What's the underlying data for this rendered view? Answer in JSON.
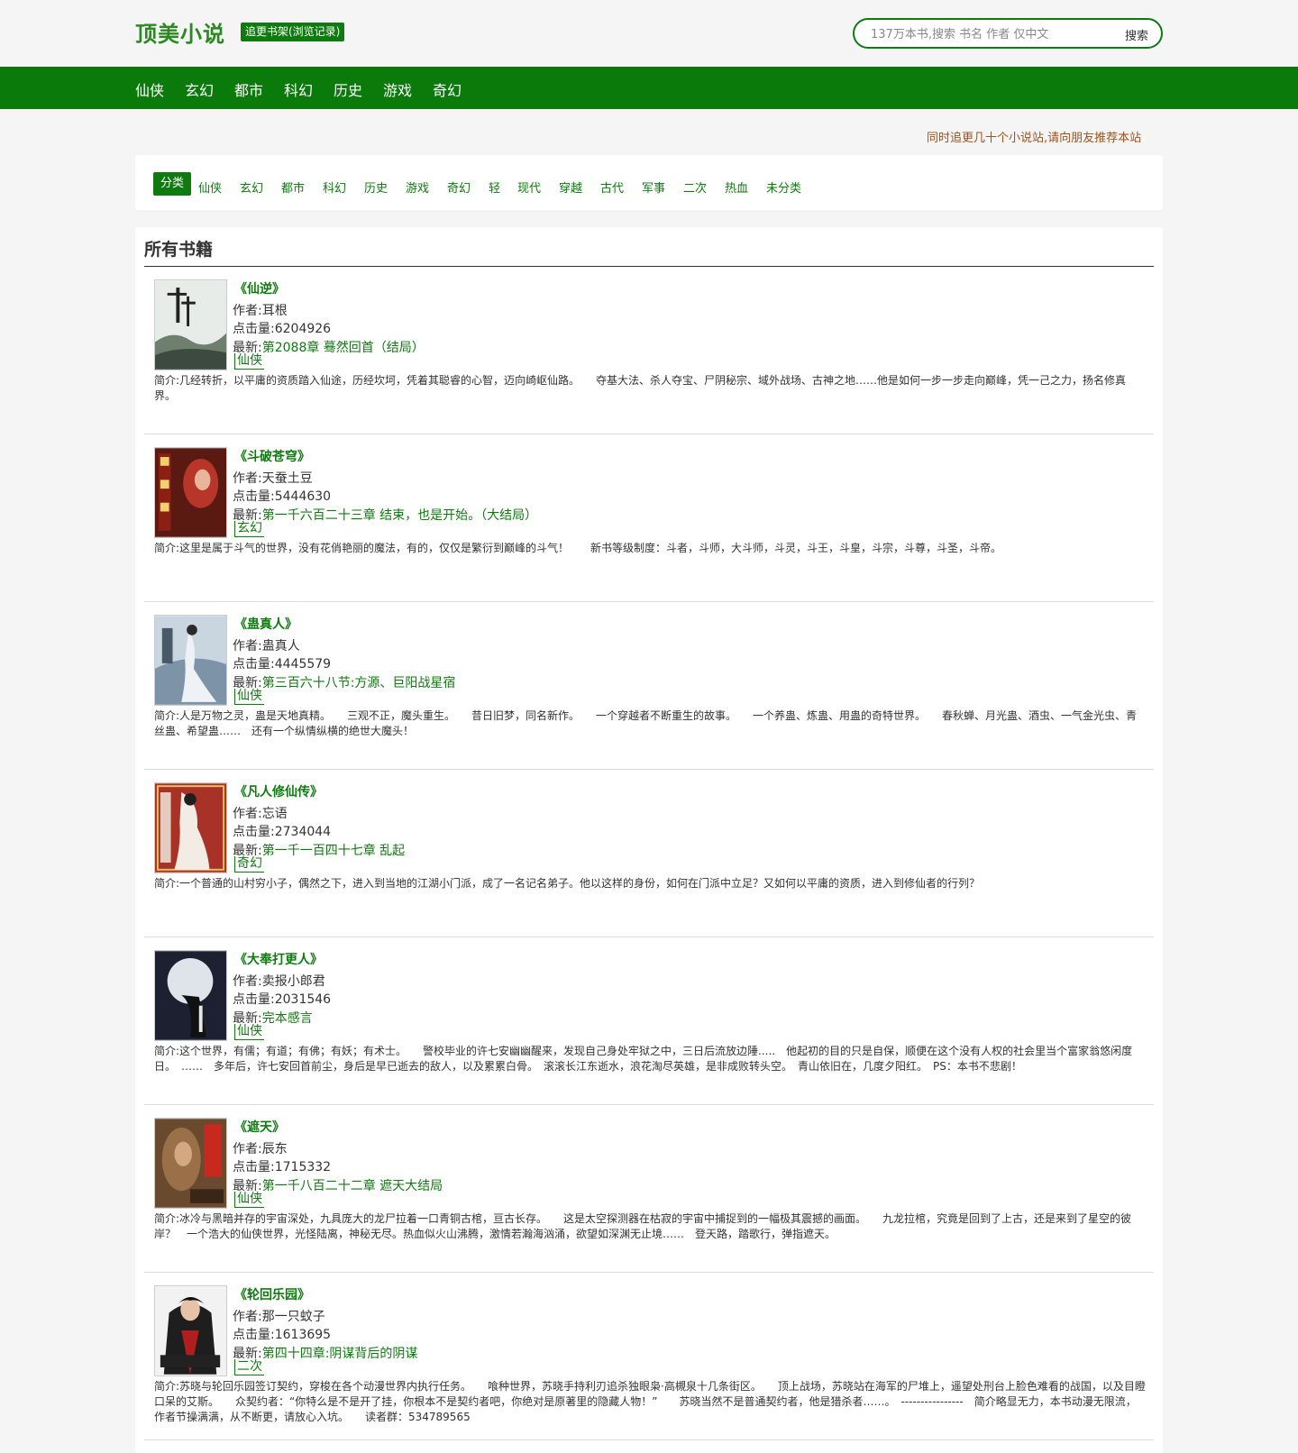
{
  "header": {
    "logo": "顶美小说",
    "shelf_button": "追更书架(浏览记录)",
    "search_placeholder": "137万本书,搜索 书名 作者 仅中文",
    "search_button": "搜索"
  },
  "nav": [
    "仙侠",
    "玄幻",
    "都市",
    "科幻",
    "历史",
    "游戏",
    "奇幻"
  ],
  "notice": "同时追更几十个小说站,请向朋友推荐本站",
  "categories": [
    "分类",
    "仙侠",
    "玄幻",
    "都市",
    "科幻",
    "历史",
    "游戏",
    "奇幻",
    "轻",
    "现代",
    "穿越",
    "古代",
    "军事",
    "二次",
    "热血",
    "未分类"
  ],
  "list_title": "所有书籍",
  "labels": {
    "author": "作者:",
    "clicks": "点击量:",
    "latest": "最新:",
    "intro": "简介:"
  },
  "books": [
    {
      "title": "《仙逆》",
      "author": "耳根",
      "clicks": "6204926",
      "latest": "第2088章 蓦然回首（结局）",
      "tag": "仙侠",
      "intro": "几经转折，以平庸的资质踏入仙途，历经坎坷，凭着其聪睿的心智，迈向崎岖仙路。　　夺基大法、杀人夺宝、尸阴秘宗、域外战场、古神之地……他是如何一步一步走向巅峰，凭一己之力，扬名修真界。"
    },
    {
      "title": "《斗破苍穹》",
      "author": "天蚕土豆",
      "clicks": "5444630",
      "latest": "第一千六百二十三章 结束，也是开始。（大结局）",
      "tag": "玄幻",
      "intro": "这里是属于斗气的世界，没有花俏艳丽的魔法，有的，仅仅是繁衍到巅峰的斗气！　　新书等级制度：斗者，斗师，大斗师，斗灵，斗王，斗皇，斗宗，斗尊，斗圣，斗帝。"
    },
    {
      "title": "《蛊真人》",
      "author": "蛊真人",
      "clicks": "4445579",
      "latest": "第三百六十八节:方源、巨阳战星宿",
      "tag": "仙侠",
      "intro": "人是万物之灵，蛊是天地真精。　　三观不正，魔头重生。　　昔日旧梦，同名新作。　　一个穿越者不断重生的故事。　　一个养蛊、炼蛊、用蛊的奇特世界。　　春秋蝉、月光蛊、酒虫、一气金光虫、青丝蛊、希望蛊……　还有一个纵情纵横的绝世大魔头！"
    },
    {
      "title": "《凡人修仙传》",
      "author": "忘语",
      "clicks": "2734044",
      "latest": "第一千一百四十七章 乱起",
      "tag": "奇幻",
      "intro": "一个普通的山村穷小子，偶然之下，进入到当地的江湖小门派，成了一名记名弟子。他以这样的身份，如何在门派中立足？又如何以平庸的资质，进入到修仙者的行列？"
    },
    {
      "title": "《大奉打更人》",
      "author": "卖报小郎君",
      "clicks": "2031546",
      "latest": "完本感言",
      "tag": "仙侠",
      "intro": "这个世界，有儒；有道；有佛；有妖；有术士。　　警校毕业的许七安幽幽醒来，发现自己身处牢狱之中，三日后流放边陲.....　他起初的目的只是自保，顺便在这个没有人权的社会里当个富家翁悠闲度日。　……　多年后，许七安回首前尘，身后是早已逝去的敌人，以及累累白骨。　滚滚长江东逝水，浪花淘尽英雄，是非成败转头空。　青山依旧在，几度夕阳红。　PS：本书不悲剧！"
    },
    {
      "title": "《遮天》",
      "author": "辰东",
      "clicks": "1715332",
      "latest": "第一千八百二十二章 遮天大结局",
      "tag": "仙侠",
      "intro": "冰冷与黑暗并存的宇宙深处，九具庞大的龙尸拉着一口青铜古棺，亘古长存。　　这是太空探测器在枯寂的宇宙中捕捉到的一幅极其震撼的画面。　　九龙拉棺，究竟是回到了上古，还是来到了星空的彼岸？　一个浩大的仙侠世界，光怪陆离，神秘无尽。热血似火山沸腾，激情若瀚海汹涌，欲望如深渊无止境……　登天路，踏歌行，弹指遮天。"
    },
    {
      "title": "《轮回乐园》",
      "author": "那一只蚊子",
      "clicks": "1613695",
      "latest": "第四十四章:阴谋背后的阴谋",
      "tag": "二次",
      "intro": "苏晓与轮回乐园签订契约，穿梭在各个动漫世界内执行任务。　　喰种世界，苏晓手持利刃追杀独眼枭·高槻泉十几条街区。　　顶上战场，苏晓站在海军的尸堆上，遥望处刑台上脸色难看的战国，以及目瞪口呆的艾斯。　　众契约者：“你特么是不是开了挂，你根本不是契约者吧，你绝对是原著里的隐藏人物！”　　苏晓当然不是普通契约者，他是猎杀者……。　----------------　简介略显无力，本书动漫无限流，作者节操满满，从不断更，请放心入坑。　　读者群：534789565"
    }
  ],
  "colors": {
    "brand_green": "#0a7a0a",
    "link_green": "#0f7a0f",
    "notice_brown": "#a0521a"
  }
}
